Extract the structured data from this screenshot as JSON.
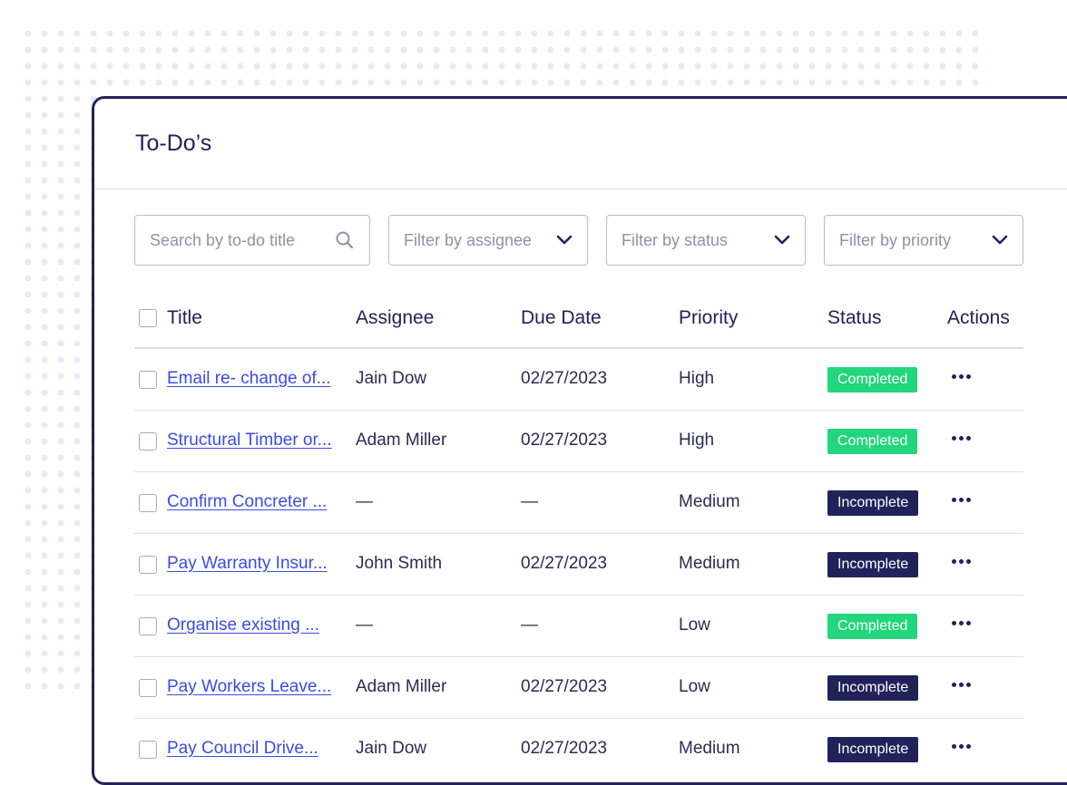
{
  "panel": {
    "title": "To-Do’s"
  },
  "filters": {
    "search": {
      "placeholder": "Search by to-do title",
      "icon": "search-icon"
    },
    "assignee": {
      "label": "Filter by assignee",
      "icon": "chevron-down-icon"
    },
    "status": {
      "label": "Filter by status",
      "icon": "chevron-down-icon"
    },
    "priority": {
      "label": "Filter by priority",
      "icon": "chevron-down-icon"
    }
  },
  "table": {
    "columns": [
      "Title",
      "Assignee",
      "Due Date",
      "Priority",
      "Status",
      "Actions"
    ],
    "rows": [
      {
        "title": "Email re- change of...",
        "assignee": "Jain Dow",
        "due": "02/27/2023",
        "priority": "High",
        "status": "Completed"
      },
      {
        "title": "Structural Timber or...",
        "assignee": "Adam Miller",
        "due": "02/27/2023",
        "priority": "High",
        "status": "Completed"
      },
      {
        "title": "Confirm Concreter ...",
        "assignee": "—",
        "due": "—",
        "priority": "Medium",
        "status": "Incomplete"
      },
      {
        "title": "Pay Warranty Insur...",
        "assignee": "John Smith",
        "due": "02/27/2023",
        "priority": "Medium",
        "status": "Incomplete"
      },
      {
        "title": "Organise existing ...",
        "assignee": "—",
        "due": "—",
        "priority": "Low",
        "status": "Completed"
      },
      {
        "title": "Pay Workers Leave...",
        "assignee": "Adam Miller",
        "due": "02/27/2023",
        "priority": "Low",
        "status": "Incomplete"
      },
      {
        "title": "Pay Council Drive...",
        "assignee": "Jain Dow",
        "due": "02/27/2023",
        "priority": "Medium",
        "status": "Incomplete"
      }
    ]
  },
  "colors": {
    "navy": "#22225a",
    "completed": "#21d67c",
    "link": "#3b4be6"
  }
}
